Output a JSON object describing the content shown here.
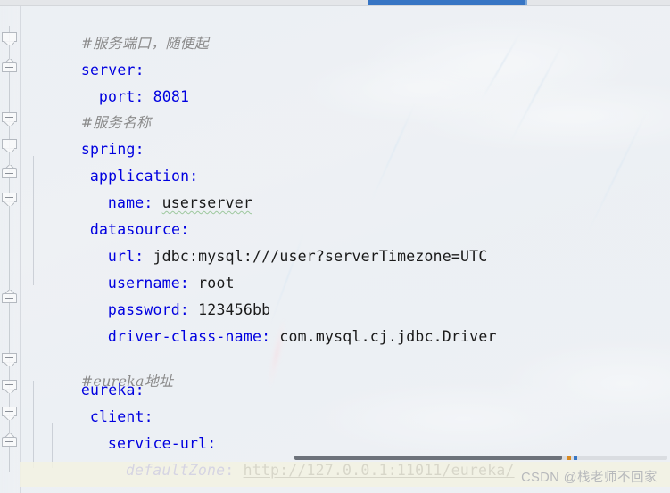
{
  "window": {
    "app": "IntelliJ IDEA Editor",
    "file_type": "YAML configuration"
  },
  "tab_bar": {
    "active_tab_indicator_color": "#3775c4"
  },
  "editor": {
    "language": "yaml",
    "colors": {
      "keyword": "#0000E0",
      "comment": "#8B8B8B",
      "value": "#1A1A1A",
      "background": "#EEF1F5",
      "gutter": "#ECEFF3",
      "highlight_band": "#F3F1E2",
      "spellcheck_squiggle": "#9EC89E"
    },
    "lines": [
      {
        "n": 1,
        "indent": 0,
        "type": "comment",
        "text": "#服务端口，随便起"
      },
      {
        "n": 2,
        "indent": 0,
        "type": "key",
        "key": "server",
        "value": ""
      },
      {
        "n": 3,
        "indent": 1,
        "type": "key",
        "key": "port",
        "value": "8081",
        "value_kind": "number"
      },
      {
        "n": 4,
        "indent": 0,
        "type": "comment",
        "text": "#服务名称"
      },
      {
        "n": 5,
        "indent": 0,
        "type": "key",
        "key": "spring",
        "value": ""
      },
      {
        "n": 6,
        "indent": 1,
        "type": "key",
        "key": "application",
        "value": ""
      },
      {
        "n": 7,
        "indent": 2,
        "type": "key",
        "key": "name",
        "value": "userserver",
        "value_kind": "typo"
      },
      {
        "n": 8,
        "indent": 1,
        "type": "key",
        "key": "datasource",
        "value": ""
      },
      {
        "n": 9,
        "indent": 2,
        "type": "key",
        "key": "url",
        "value": "jdbc:mysql:///user?serverTimezone=UTC"
      },
      {
        "n": 10,
        "indent": 2,
        "type": "key",
        "key": "username",
        "value": "root"
      },
      {
        "n": 11,
        "indent": 2,
        "type": "key",
        "key": "password",
        "value": "123456bb"
      },
      {
        "n": 12,
        "indent": 2,
        "type": "key",
        "key": "driver-class-name",
        "value": "com.mysql.cj.jdbc.Driver"
      },
      {
        "n": 13,
        "indent": 0,
        "type": "blank",
        "text": ""
      },
      {
        "n": 14,
        "indent": 0,
        "type": "comment",
        "text": "#eureka地址"
      },
      {
        "n": 15,
        "indent": 0,
        "type": "key",
        "key": "eureka",
        "value": ""
      },
      {
        "n": 16,
        "indent": 1,
        "type": "key",
        "key": "client",
        "value": ""
      },
      {
        "n": 17,
        "indent": 2,
        "type": "key",
        "key": "service-url",
        "value": ""
      },
      {
        "n": 18,
        "indent": 3,
        "type": "key",
        "key": "defaultZone",
        "value": "http://127.0.0.1:11011/eureka/",
        "key_kind": "italic",
        "value_kind": "link"
      }
    ],
    "fold_markers": [
      {
        "line": 2,
        "state": "expanded"
      },
      {
        "line": 3,
        "state": "collapsed-end"
      },
      {
        "line": 5,
        "state": "expanded"
      },
      {
        "line": 6,
        "state": "expanded"
      },
      {
        "line": 7,
        "state": "collapsed-end"
      },
      {
        "line": 8,
        "state": "expanded"
      },
      {
        "line": 12,
        "state": "collapsed-end"
      },
      {
        "line": 15,
        "state": "expanded"
      },
      {
        "line": 16,
        "state": "expanded"
      },
      {
        "line": 17,
        "state": "expanded"
      },
      {
        "line": 18,
        "state": "collapsed-end"
      }
    ]
  },
  "scrollbar": {
    "orientation": "horizontal",
    "marker_warning_color": "#D98A21",
    "marker_info_color": "#3775C4"
  },
  "watermark": {
    "text": "CSDN @栈老师不回家"
  }
}
